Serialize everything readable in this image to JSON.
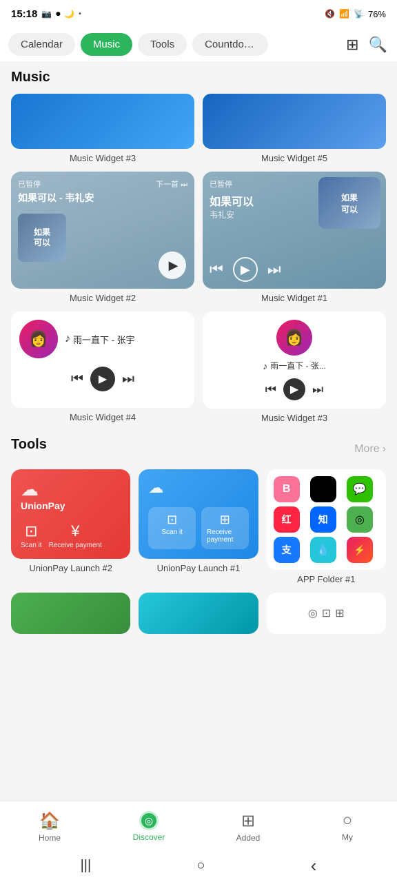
{
  "statusBar": {
    "time": "15:18",
    "battery": "76%",
    "batteryIcon": "🔋"
  },
  "topNav": {
    "tabs": [
      {
        "id": "calendar",
        "label": "Calendar",
        "active": false
      },
      {
        "id": "music",
        "label": "Music",
        "active": true
      },
      {
        "id": "tools",
        "label": "Tools",
        "active": false
      },
      {
        "id": "countdown",
        "label": "Countdown",
        "active": false
      }
    ]
  },
  "music": {
    "sectionTitle": "Music",
    "widgets": [
      {
        "id": "w3",
        "label": "Music Widget #3"
      },
      {
        "id": "w5",
        "label": "Music Widget #5"
      },
      {
        "id": "w2",
        "label": "Music Widget #2",
        "song": "如果可以 - 韦礼安",
        "status": "已暂停",
        "next": "下一首"
      },
      {
        "id": "w1",
        "label": "Music Widget #1",
        "song": "如果可以",
        "artist": "韦礼安",
        "status": "已暂停"
      },
      {
        "id": "w4",
        "label": "Music Widget #4",
        "song": "雨一直下 - 张宇"
      },
      {
        "id": "w3b",
        "label": "Music Widget #3",
        "song": "雨一直下 - 张..."
      }
    ]
  },
  "tools": {
    "sectionTitle": "Tools",
    "moreLabel": "More",
    "items": [
      {
        "id": "unionpay2",
        "label": "UnionPay Launch #2",
        "type": "red"
      },
      {
        "id": "unionpay1",
        "label": "UnionPay Launch #1",
        "type": "blue"
      },
      {
        "id": "appfolder1",
        "label": "APP Folder #1",
        "type": "folder"
      }
    ]
  },
  "bottomNav": {
    "items": [
      {
        "id": "home",
        "label": "Home",
        "icon": "🏠",
        "active": false
      },
      {
        "id": "discover",
        "label": "Discover",
        "icon": "◎",
        "active": true
      },
      {
        "id": "added",
        "label": "Added",
        "icon": "⊞",
        "active": false
      },
      {
        "id": "my",
        "label": "My",
        "icon": "○",
        "active": false
      }
    ]
  },
  "sysNav": {
    "menuIcon": "|||",
    "homeIcon": "○",
    "backIcon": "‹"
  }
}
